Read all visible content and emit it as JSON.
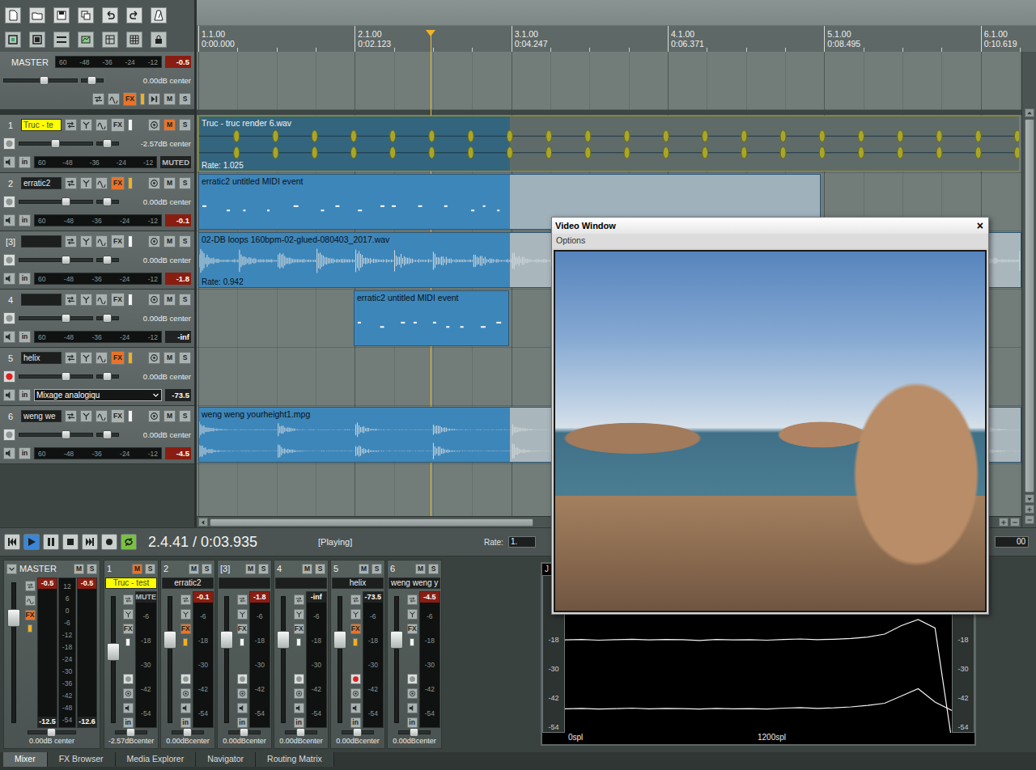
{
  "labels": {
    "mute": "M",
    "solo": "S",
    "fx": "FX",
    "input": "in"
  },
  "ruler": {
    "markers": [
      {
        "bar": "1.1.00",
        "time": "0:00.000"
      },
      {
        "bar": "2.1.00",
        "time": "0:02.123"
      },
      {
        "bar": "3.1.00",
        "time": "0:04.247"
      },
      {
        "bar": "4.1.00",
        "time": "0:06.371"
      },
      {
        "bar": "5.1.00",
        "time": "0:08.495"
      },
      {
        "bar": "6.1.00",
        "time": "0:10.619"
      }
    ]
  },
  "tcp_scale": [
    "60",
    "-48",
    "-36",
    "-24",
    "-12"
  ],
  "master": {
    "name": "MASTER",
    "reading": "-0.5",
    "hot": true,
    "volume": "0.00dB center",
    "fader": 0.56,
    "pan": 0.5,
    "fx_active": true,
    "muted": false,
    "solo": false
  },
  "tracks": [
    {
      "number": "1",
      "name": "Truc - te",
      "selected": true,
      "muted": true,
      "solo": false,
      "fx_active": false,
      "armed": false,
      "fader": 0.5,
      "pan": 0.5,
      "volume": "-2.57dB center",
      "reading": "MUTED",
      "hot": false,
      "item": {
        "label": "Truc - truc render 6.wav",
        "rate": "Rate: 1.025",
        "kind": "transients",
        "selected": true,
        "channels": 2
      }
    },
    {
      "number": "2",
      "name": "erratic2",
      "selected": false,
      "muted": false,
      "solo": false,
      "fx_active": true,
      "armed": false,
      "fader": 0.64,
      "pan": 0.5,
      "volume": "0.00dB center",
      "reading": "-0.1",
      "hot": true,
      "item": {
        "label": "erratic2 untitled MIDI event",
        "kind": "midi",
        "selected": true
      }
    },
    {
      "number": "[3]",
      "name": "",
      "selected": false,
      "muted": false,
      "solo": false,
      "fx_active": false,
      "armed": false,
      "fader": 0.64,
      "pan": 0.5,
      "volume": "0.00dB center",
      "reading": "-1.8",
      "hot": true,
      "item": {
        "label": "02-DB loops 160bpm-02-glued-080403_2017.wav",
        "rate": "Rate: 0.942",
        "kind": "audio",
        "selected": true,
        "channels": 1
      }
    },
    {
      "number": "4",
      "name": "",
      "selected": false,
      "muted": false,
      "solo": false,
      "fx_active": false,
      "armed": false,
      "fader": 0.64,
      "pan": 0.5,
      "volume": "0.00dB center",
      "reading": "-inf",
      "hot": false,
      "item": {
        "label": "erratic2 untitled MIDI event",
        "kind": "midi",
        "selected": true
      }
    },
    {
      "number": "5",
      "name": "helix",
      "selected": false,
      "muted": false,
      "solo": false,
      "fx_active": true,
      "armed": true,
      "fader": 0.64,
      "pan": 0.5,
      "volume": "0.00dB center",
      "reading": "-73.5",
      "hot": false,
      "input": "Mixage analogiqu"
    },
    {
      "number": "6",
      "name": "weng we",
      "selected": false,
      "muted": false,
      "solo": false,
      "fx_active": false,
      "armed": false,
      "fader": 0.64,
      "pan": 0.5,
      "volume": "0.00dB center",
      "reading": "-4.5",
      "hot": true,
      "item": {
        "label": "weng weng yourheight1.mpg",
        "kind": "audio",
        "selected": true,
        "channels": 2
      }
    }
  ],
  "transport": {
    "buttons": [
      {
        "selected": false
      },
      {
        "selected": true
      },
      {
        "selected": false
      },
      {
        "selected": false
      },
      {
        "selected": false
      },
      {
        "selected": false
      },
      {
        "selected": true
      }
    ],
    "position": "2.4.41 / 0:03.935",
    "status": "[Playing]",
    "rate_label": "Rate:",
    "rate": "1.",
    "right_field": "00"
  },
  "mixer": {
    "master": {
      "name": "MASTER",
      "readings": [
        "-0.5",
        "-0.5"
      ],
      "hot": true,
      "bottom": [
        "-12.5",
        "-12.6"
      ],
      "scale": [
        "12",
        "6",
        "0",
        "-6",
        "-12",
        "-18",
        "-24",
        "-30",
        "-36",
        "-42",
        "-48",
        "-54"
      ],
      "fader": 0.75,
      "volume": "0.00dB center",
      "fx_active": true,
      "muted": false,
      "solo": false
    },
    "strip_scale": [
      "-6",
      "-18",
      "-30",
      "-42",
      "-54"
    ],
    "strips": [
      {
        "number": "1",
        "name": "Truc - test",
        "selected": true,
        "muted": true,
        "solo": false,
        "fx_active": false,
        "armed": false,
        "reading": "MUTE",
        "hot": false,
        "fader": 0.56,
        "volume": "-2.57dBcenter"
      },
      {
        "number": "2",
        "name": "erratic2",
        "selected": false,
        "muted": false,
        "solo": false,
        "fx_active": true,
        "armed": false,
        "reading": "-0.1",
        "hot": true,
        "fader": 0.66,
        "volume": "0.00dBcenter"
      },
      {
        "number": "[3]",
        "name": "",
        "selected": false,
        "muted": false,
        "solo": false,
        "fx_active": false,
        "armed": false,
        "reading": "-1.8",
        "hot": true,
        "fader": 0.66,
        "volume": "0.00dBcenter"
      },
      {
        "number": "4",
        "name": "",
        "selected": false,
        "muted": false,
        "solo": false,
        "fx_active": false,
        "armed": false,
        "reading": "-inf",
        "hot": false,
        "fader": 0.66,
        "volume": "0.00dBcenter"
      },
      {
        "number": "5",
        "name": "helix",
        "selected": false,
        "muted": false,
        "solo": false,
        "fx_active": true,
        "armed": true,
        "reading": "-73.5",
        "hot": false,
        "fader": 0.66,
        "volume": "0.00dBcenter"
      },
      {
        "number": "6",
        "name": "weng weng y",
        "selected": false,
        "muted": false,
        "solo": false,
        "fx_active": false,
        "armed": false,
        "reading": "-4.5",
        "hot": true,
        "fader": 0.66,
        "volume": "0.00dBcenter"
      }
    ]
  },
  "js_panel": {
    "title": "J",
    "scale": [
      "-18",
      "-30",
      "-42",
      "-54"
    ],
    "x_labels": [
      "0spl",
      "1200spl"
    ],
    "series": [
      [
        -18.4,
        -18.2,
        -18.5,
        -18.3,
        -18.1,
        -18.4,
        -18.2,
        -18.3,
        -18.6,
        -18.2,
        -18.4,
        -18.3,
        -18.5,
        -18.2,
        -18.0,
        -18.3,
        -18.1,
        -17.8,
        -17.2,
        -16.0,
        -12.5,
        -10.0,
        -13.5,
        -60.0
      ],
      [
        -46.8,
        -46.6,
        -46.9,
        -46.7,
        -46.5,
        -46.8,
        -46.6,
        -46.7,
        -46.9,
        -46.6,
        -46.8,
        -46.7,
        -46.9,
        -46.5,
        -46.3,
        -46.6,
        -46.4,
        -46.0,
        -45.4,
        -44.5,
        -41.5,
        -38.5,
        -44.0,
        -47.5
      ]
    ]
  },
  "video_window": {
    "title": "Video Window",
    "close": "×",
    "menu": [
      "Options"
    ]
  },
  "tabs": [
    {
      "label": "Mixer",
      "selected": true
    },
    {
      "label": "FX Browser",
      "selected": false
    },
    {
      "label": "Media Explorer",
      "selected": false
    },
    {
      "label": "Navigator",
      "selected": false
    },
    {
      "label": "Routing Matrix",
      "selected": false
    }
  ]
}
